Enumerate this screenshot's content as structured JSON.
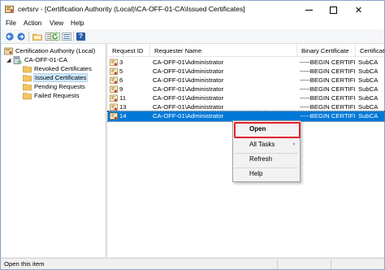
{
  "window": {
    "title": "certsrv - [Certification Authority (Local)\\CA-OFF-01-CA\\Issued Certificates]",
    "close_glyph": "✕"
  },
  "menu": [
    "File",
    "Action",
    "View",
    "Help"
  ],
  "toolbar": {
    "icons": [
      "back-arrow-icon",
      "forward-arrow-icon",
      "folder-up-icon",
      "properties-icon",
      "refresh-icon",
      "export-list-icon",
      "help-icon"
    ],
    "help_glyph": "?"
  },
  "tree": {
    "expander_glyph": "◢",
    "items": [
      {
        "label": "Certification Authority (Local)",
        "icon": "certification-authority-icon"
      },
      {
        "label": "CA-OFF-01-CA",
        "icon": "ca-server-icon"
      },
      {
        "label": "Revoked Certificates",
        "icon": "folder-icon"
      },
      {
        "label": "Issued Certificates",
        "icon": "folder-icon",
        "selected": true
      },
      {
        "label": "Pending Requests",
        "icon": "folder-icon"
      },
      {
        "label": "Failed Requests",
        "icon": "folder-icon"
      }
    ]
  },
  "list": {
    "columns": [
      "Request ID",
      "Requester Name",
      "Binary Certificate",
      "Certificat"
    ],
    "rows": [
      {
        "id": "3",
        "requester": "CA-OFF-01\\Administrator",
        "binary": "-----BEGIN CERTIFI...",
        "template": "SubCA"
      },
      {
        "id": "5",
        "requester": "CA-OFF-01\\Administrator",
        "binary": "-----BEGIN CERTIFI...",
        "template": "SubCA"
      },
      {
        "id": "6",
        "requester": "CA-OFF-01\\Administrator",
        "binary": "-----BEGIN CERTIFI...",
        "template": "SubCA"
      },
      {
        "id": "9",
        "requester": "CA-OFF-01\\Administrator",
        "binary": "-----BEGIN CERTIFI...",
        "template": "SubCA"
      },
      {
        "id": "11",
        "requester": "CA-OFF-01\\Administrator",
        "binary": "-----BEGIN CERTIFI...",
        "template": "SubCA"
      },
      {
        "id": "13",
        "requester": "CA-OFF-01\\Administrator",
        "binary": "-----BEGIN CERTIFI...",
        "template": "SubCA"
      },
      {
        "id": "14",
        "requester": "CA-OFF-01\\Administrator",
        "binary": "-----BEGIN CERTIFI...",
        "template": "SubCA",
        "selected": true
      }
    ]
  },
  "context_menu": {
    "items": [
      "Open",
      "All Tasks",
      "Refresh",
      "Help"
    ],
    "submenu_arrow": "›"
  },
  "status_bar": {
    "text": "Open this item"
  },
  "colors": {
    "selection": "#0078d7",
    "tree_selection": "#cce8ff",
    "highlight_box": "#e0212c",
    "folder": "#f2c55c"
  }
}
